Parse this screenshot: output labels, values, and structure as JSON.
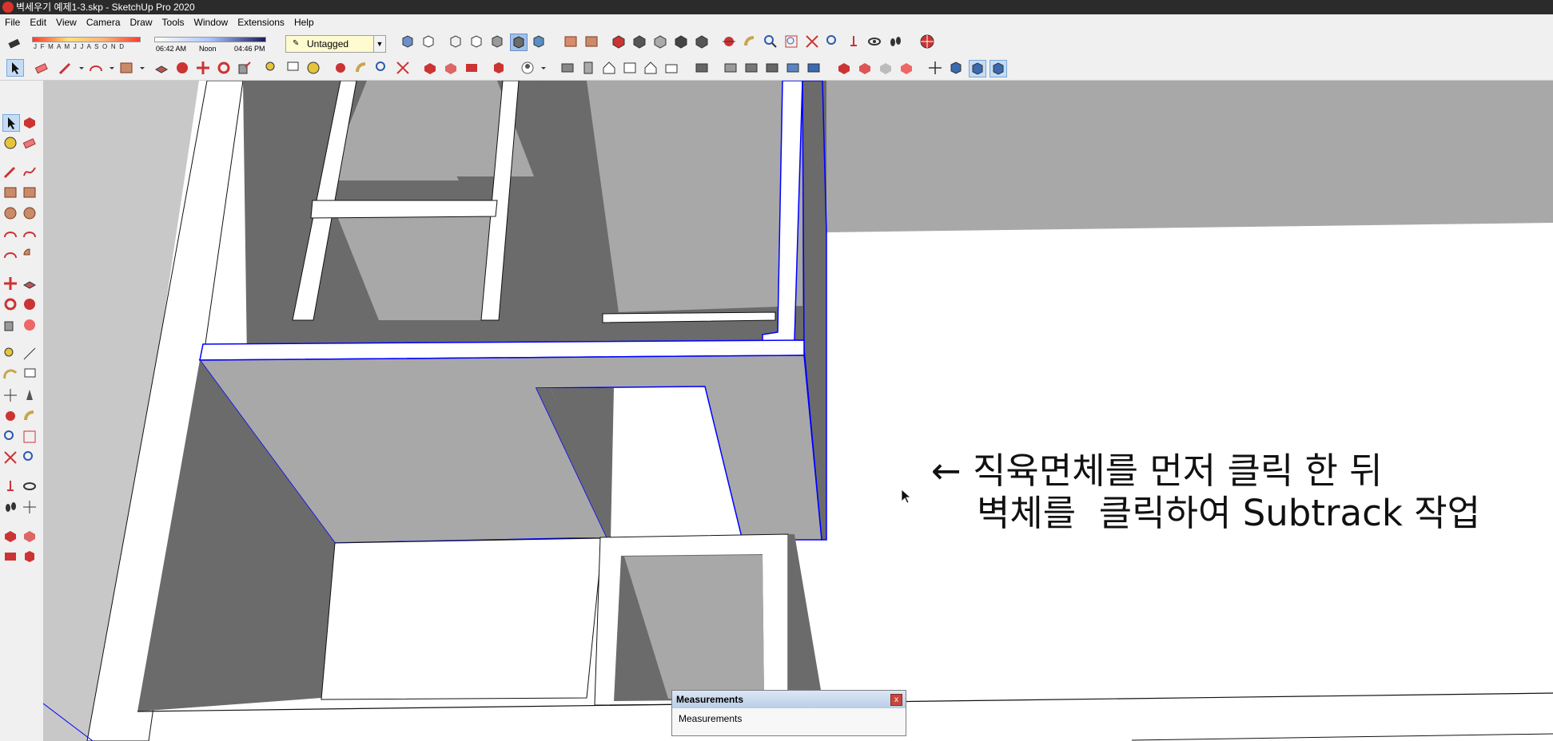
{
  "window": {
    "title": "벽세우기 예제1-3.skp - SketchUp Pro 2020"
  },
  "menu": [
    "File",
    "Edit",
    "View",
    "Camera",
    "Draw",
    "Tools",
    "Window",
    "Extensions",
    "Help"
  ],
  "shadow": {
    "months": "J F M A M J J A S O N D",
    "time_start": "06:42 AM",
    "time_mid": "Noon",
    "time_end": "04:46 PM"
  },
  "tag_selector": {
    "value": "Untagged"
  },
  "annotation": {
    "arrow": "←",
    "line1": "직육면체를 먼저 클릭 한 뒤",
    "line2": "벽체를  클릭하여 Subtrack 작업"
  },
  "measurements": {
    "title": "Measurements",
    "label": "Measurements",
    "close": "x"
  },
  "colors": {
    "selection": "#0000ff",
    "wall_dark": "#6b6b6b",
    "wall_mid": "#a8a8a8",
    "viewport_bg": "#ffffff"
  }
}
